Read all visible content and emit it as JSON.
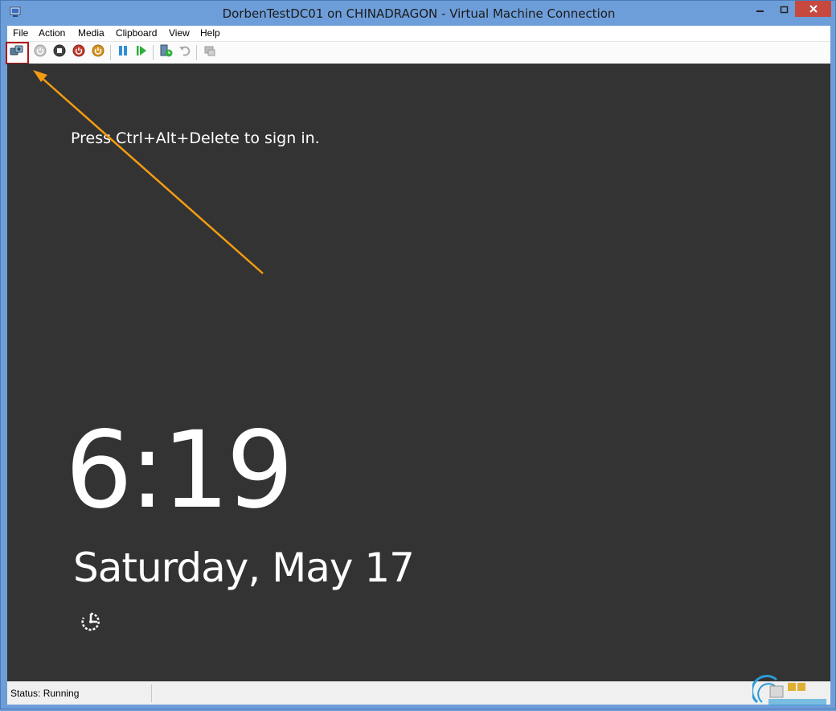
{
  "window": {
    "title": "DorbenTestDC01 on CHINADRAGON - Virtual Machine Connection"
  },
  "menu": {
    "items": [
      "File",
      "Action",
      "Media",
      "Clipboard",
      "View",
      "Help"
    ]
  },
  "toolbar": {
    "buttons": [
      {
        "name": "ctrl-alt-del-icon",
        "state": "enabled",
        "highlighted": true
      },
      {
        "name": "start-icon",
        "state": "disabled"
      },
      {
        "name": "turn-off-icon",
        "state": "enabled"
      },
      {
        "name": "shut-down-icon",
        "state": "enabled"
      },
      {
        "name": "save-icon",
        "state": "enabled"
      },
      {
        "name": "pause-icon",
        "state": "enabled"
      },
      {
        "name": "reset-icon",
        "state": "enabled"
      },
      {
        "name": "checkpoint-icon",
        "state": "enabled"
      },
      {
        "name": "revert-icon",
        "state": "disabled"
      },
      {
        "name": "enhanced-session-icon",
        "state": "disabled"
      }
    ],
    "highlight_color": "#b0161b"
  },
  "vm_screen": {
    "sign_in_prompt": "Press Ctrl+Alt+Delete to sign in.",
    "time": "6:19",
    "date": "Saturday, May 17",
    "background_color": "#333333",
    "accessibility_icon": "ease-of-access-icon"
  },
  "annotation": {
    "arrow_color": "#f39c12"
  },
  "statusbar": {
    "status": "Status: Running"
  }
}
